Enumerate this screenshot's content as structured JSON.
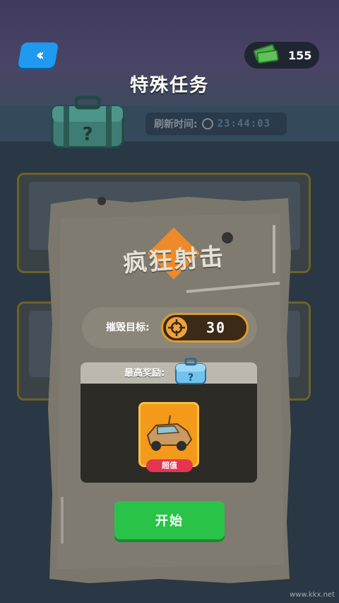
{
  "header": {
    "back_icon": "double-chevron-left-icon",
    "currency_icon": "cash-stack-icon",
    "currency_amount": "155",
    "title": "特殊任务"
  },
  "refresh": {
    "label": "刷新时间:",
    "icon": "clock-icon",
    "time": "23:44:03"
  },
  "mission_dialog": {
    "mission_name": "疯狂射击",
    "target_label": "摧毁目标:",
    "target_icon": "crosshair-icon",
    "target_value": "30",
    "reward_label": "最高奖励:",
    "reward_chest_icon": "mystery-chest-icon",
    "reward_item_icon": "armored-truck-icon",
    "reward_badge": "超值",
    "start_label": "开始"
  },
  "colors": {
    "accent_orange": "#ee8a2a",
    "start_green": "#2ac349",
    "back_blue": "#1e9bf0",
    "badge_red": "#e53550"
  },
  "watermark": "www.kkx.net"
}
